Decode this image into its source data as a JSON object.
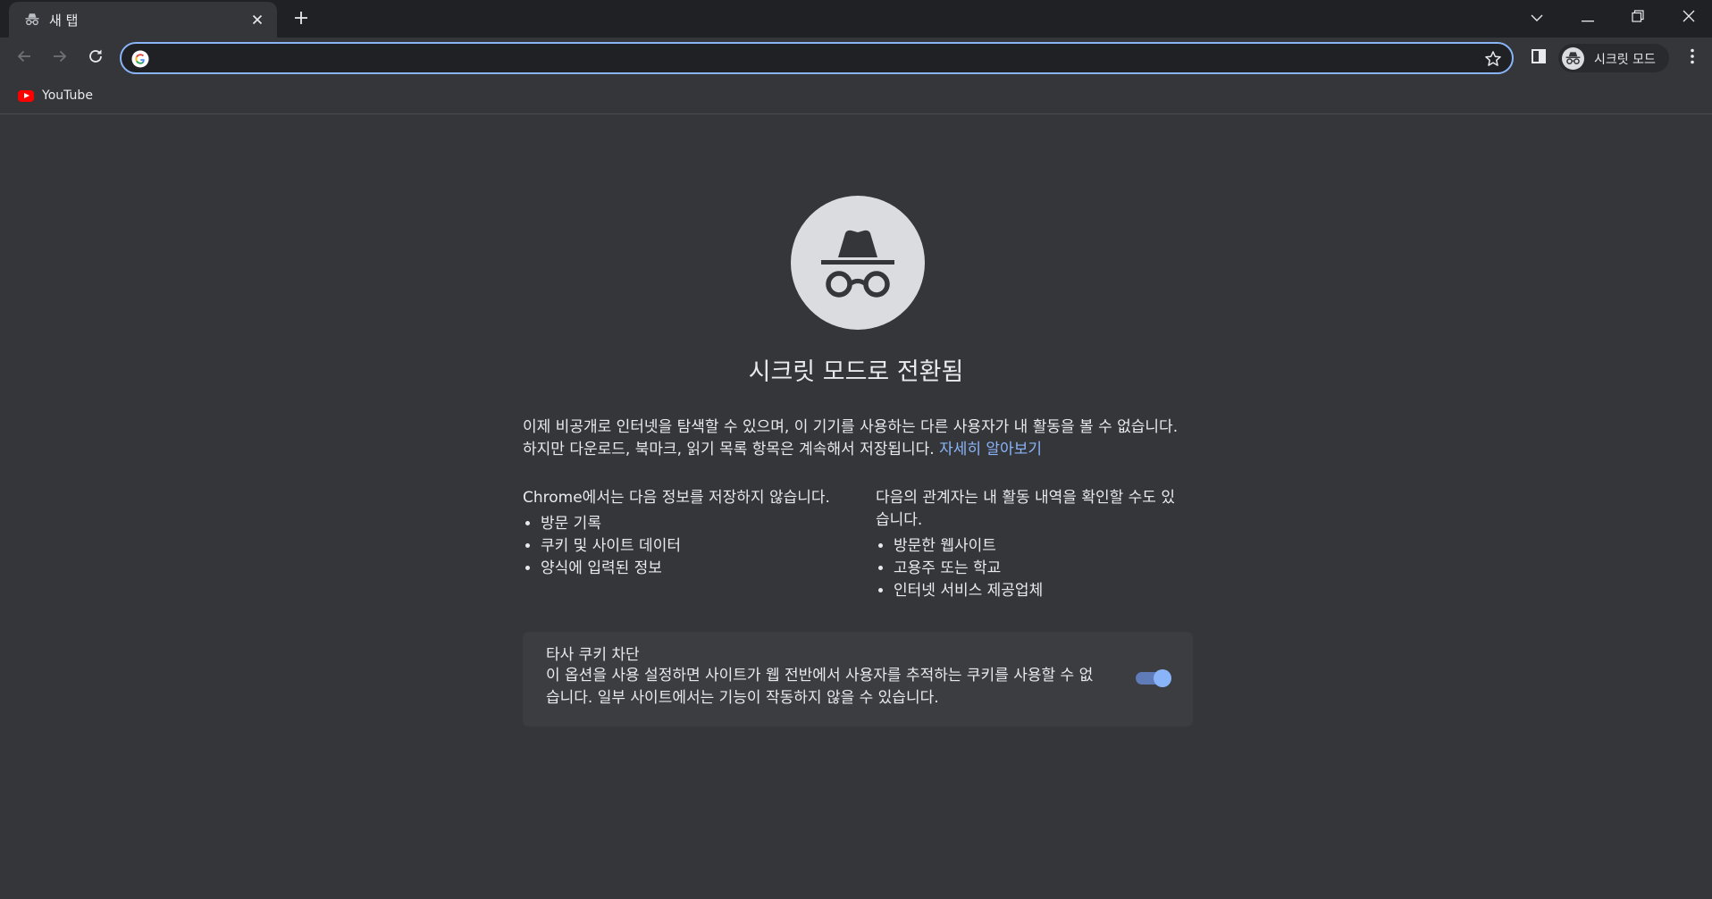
{
  "tab": {
    "title": "새 탭",
    "icon": "incognito-icon"
  },
  "omnibox": {
    "value": "",
    "placeholder": ""
  },
  "profile": {
    "label": "시크릿 모드"
  },
  "bookmarks": [
    {
      "label": "YouTube",
      "icon": "youtube-icon"
    }
  ],
  "ntp": {
    "title": "시크릿 모드로 전환됨",
    "intro": "이제 비공개로 인터넷을 탐색할 수 있으며, 이 기기를 사용하는 다른 사용자가 내 활동을 볼 수 없습니다. 하지만 다운로드, 북마크, 읽기 목록 항목은 계속해서 저장됩니다.",
    "learn_more": "자세히 알아보기",
    "not_saved": {
      "heading": "Chrome에서는 다음 정보를 저장하지 않습니다.",
      "items": [
        "방문 기록",
        "쿠키 및 사이트 데이터",
        "양식에 입력된 정보"
      ]
    },
    "visible_to": {
      "heading": "다음의 관계자는 내 활동 내역을 확인할 수도 있습니다.",
      "items": [
        "방문한 웹사이트",
        "고용주 또는 학교",
        "인터넷 서비스 제공업체"
      ]
    },
    "cookie_card": {
      "title": "타사 쿠키 차단",
      "description": "이 옵션을 사용 설정하면 사이트가 웹 전반에서 사용자를 추적하는 쿠키를 사용할 수 없습니다. 일부 사이트에서는 기능이 작동하지 않을 수 있습니다.",
      "enabled": true
    }
  },
  "colors": {
    "frame": "#202124",
    "surface": "#35363a",
    "accent": "#8ab4f8",
    "card": "#3c3d41"
  }
}
